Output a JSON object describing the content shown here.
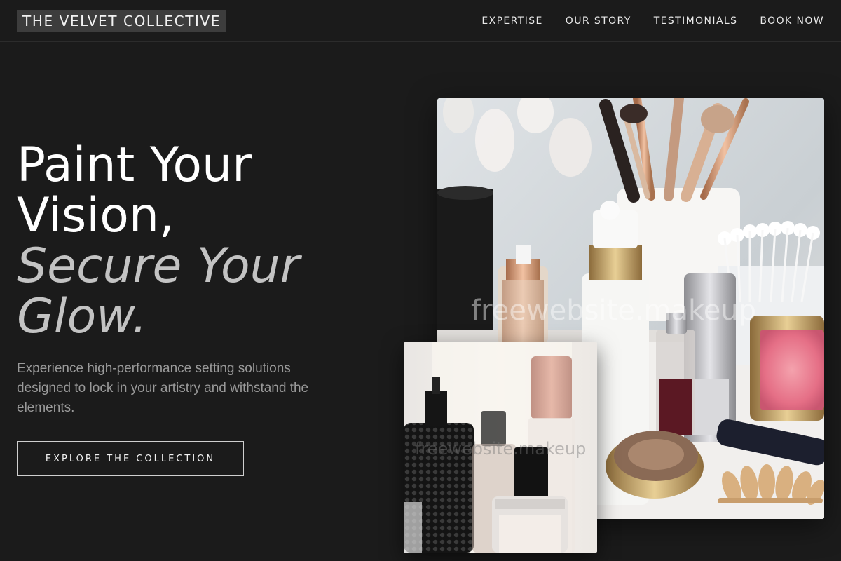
{
  "brand": {
    "name": "THE VELVET COLLECTIVE"
  },
  "nav": {
    "items": [
      "EXPERTISE",
      "OUR STORY",
      "TESTIMONIALS",
      "BOOK NOW"
    ]
  },
  "hero": {
    "headline_line1": "Paint Your",
    "headline_line2": "Vision,",
    "headline_accent1": "Secure Your",
    "headline_accent2": "Glow.",
    "subtext": "Experience high-performance setting solutions designed to lock in your artistry and withstand the elements.",
    "cta_label": "EXPLORE THE COLLECTION"
  },
  "images": {
    "main_watermark": "freewebsite.makeup",
    "small_watermark": "freewebsite.makeup"
  },
  "colors": {
    "background": "#1b1b1b",
    "logo_bg": "#3d3d3d",
    "accent_text": "#c3c3c3",
    "muted_text": "#9a9a9a"
  }
}
